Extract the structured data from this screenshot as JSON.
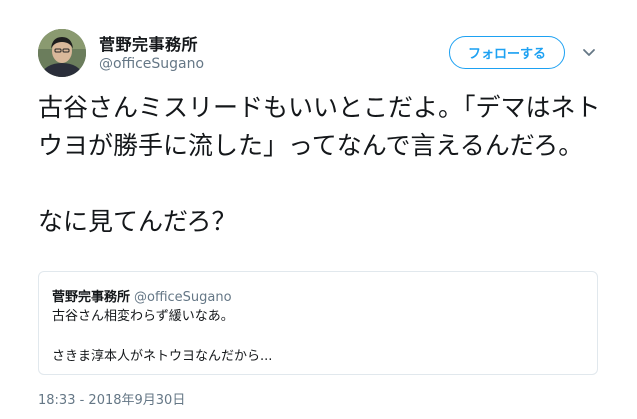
{
  "author": {
    "display_name": "菅野完事務所",
    "handle": "@officeSugano"
  },
  "follow_button": {
    "label": "フォローする"
  },
  "tweet": {
    "text": "古谷さんミスリードもいいとこだよ。「デマはネトウヨが勝手に流した」ってなんで言えるんだろ。\n\nなに見てんだろ？"
  },
  "quoted_tweet": {
    "display_name": "菅野完事務所",
    "handle": "@officeSugano",
    "text": "古谷さん相変わらず緩いなあ。\n\nさきま淳本人がネトウヨなんだから..."
  },
  "timestamp": "18:33 - 2018年9月30日",
  "colors": {
    "accent": "#1da1f2",
    "secondary_text": "#657786",
    "border": "#e1e8ed"
  },
  "icons": {
    "avatar": "profile-photo",
    "menu": "chevron-down-icon"
  }
}
